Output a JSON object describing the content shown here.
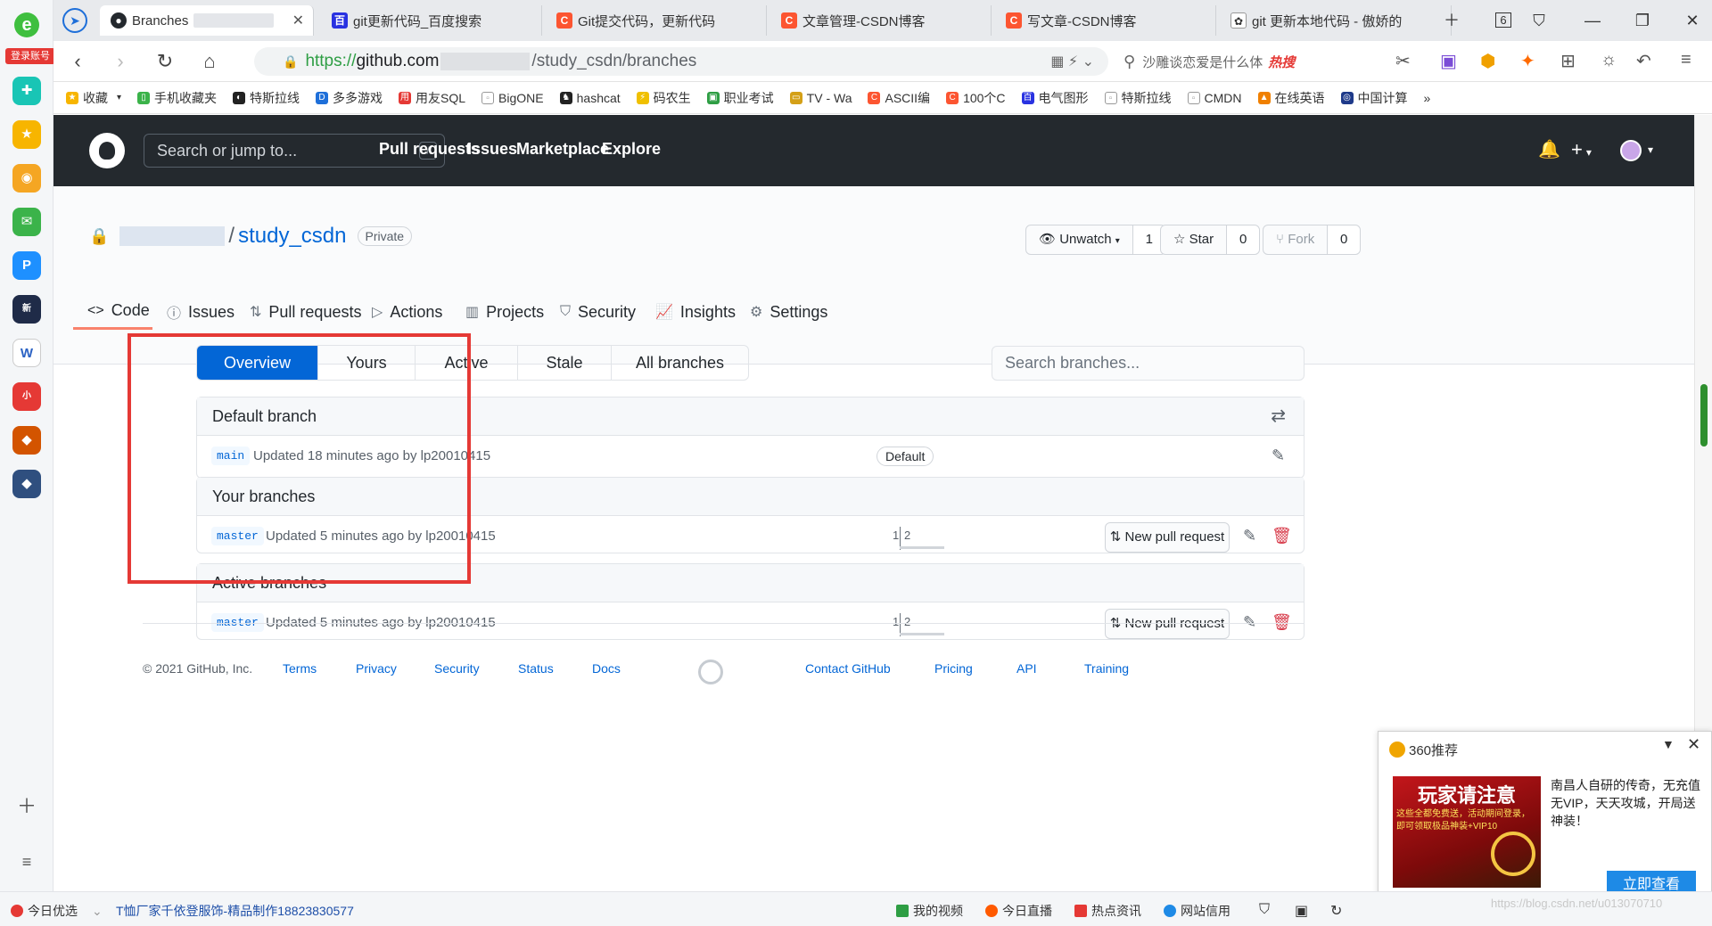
{
  "browser": {
    "login_label": "登录账号",
    "tabs": [
      {
        "title": "Branches",
        "active": true
      },
      {
        "title": "git更新代码_百度搜索"
      },
      {
        "title": "Git提交代码，更新代码"
      },
      {
        "title": "文章管理-CSDN博客"
      },
      {
        "title": "写文章-CSDN博客"
      },
      {
        "title": "git 更新本地代码 - 傲娇的"
      }
    ],
    "tab_count": "6",
    "address": {
      "scheme": "https://",
      "host": "github.com",
      "path": "/study_csdn/branches"
    },
    "search_placeholder": "沙雕谈恋爱是什么体",
    "search_hot": "热搜",
    "bookmarks": [
      "收藏",
      "手机收藏夹",
      "特斯拉线",
      "多多游戏",
      "用友SQL",
      "BigONE",
      "hashcat",
      "码农生",
      "职业考试",
      "TV - Wa",
      "ASCII编",
      "100个C",
      "电气图形",
      "特斯拉线",
      "CMDN",
      "在线英语",
      "中国计算"
    ]
  },
  "github": {
    "search_placeholder": "Search or jump to...",
    "search_key": "/",
    "nav": [
      "Pull requests",
      "Issues",
      "Marketplace",
      "Explore"
    ],
    "repo": {
      "name": "study_csdn",
      "visibility": "Private",
      "unwatch_label": "Unwatch",
      "unwatch_count": "1",
      "star_label": "Star",
      "star_count": "0",
      "fork_label": "Fork",
      "fork_count": "0"
    },
    "tabs": [
      "Code",
      "Issues",
      "Pull requests",
      "Actions",
      "Projects",
      "Security",
      "Insights",
      "Settings"
    ],
    "branch_filters": [
      "Overview",
      "Yours",
      "Active",
      "Stale",
      "All branches"
    ],
    "branch_search_placeholder": "Search branches...",
    "sections": [
      {
        "title": "Default branch",
        "branch": "main",
        "updated": "Updated 18 minutes ago by lp20010415",
        "badge": "Default"
      },
      {
        "title": "Your branches",
        "branch": "master",
        "updated": "Updated 5 minutes ago by lp20010415",
        "behind": "1",
        "ahead": "2",
        "pr_label": "New pull request"
      },
      {
        "title": "Active branches",
        "branch": "master",
        "updated": "Updated 5 minutes ago by lp20010415",
        "behind": "1",
        "ahead": "2",
        "pr_label": "New pull request"
      }
    ],
    "footer": {
      "copyright": "© 2021 GitHub, Inc.",
      "left_links": [
        "Terms",
        "Privacy",
        "Security",
        "Status",
        "Docs"
      ],
      "right_links": [
        "Contact GitHub",
        "Pricing",
        "API",
        "Training"
      ]
    }
  },
  "popup": {
    "title": "360推荐",
    "ad_headline": "玩家请注意",
    "ad_sub": "这些全都免费送，活动期间登录，即可领取极品神装+VIP10",
    "description": "南昌人自研的传奇，无充值无VIP，天天攻城，开局送神装！",
    "button": "立即查看"
  },
  "statusbar": {
    "left": "今日优选",
    "news": "T恤厂家千依登服饰-精品制作18823830577",
    "items": [
      "我的视频",
      "今日直播",
      "热点资讯",
      "网站信用"
    ]
  },
  "watermark": "https://blog.csdn.net/u013070710",
  "colors": {
    "github_header": "#24292e",
    "link_blue": "#0366d6",
    "highlight_red": "#e53935",
    "tab_underline": "#f9826c",
    "delete_red": "#d73a49"
  }
}
